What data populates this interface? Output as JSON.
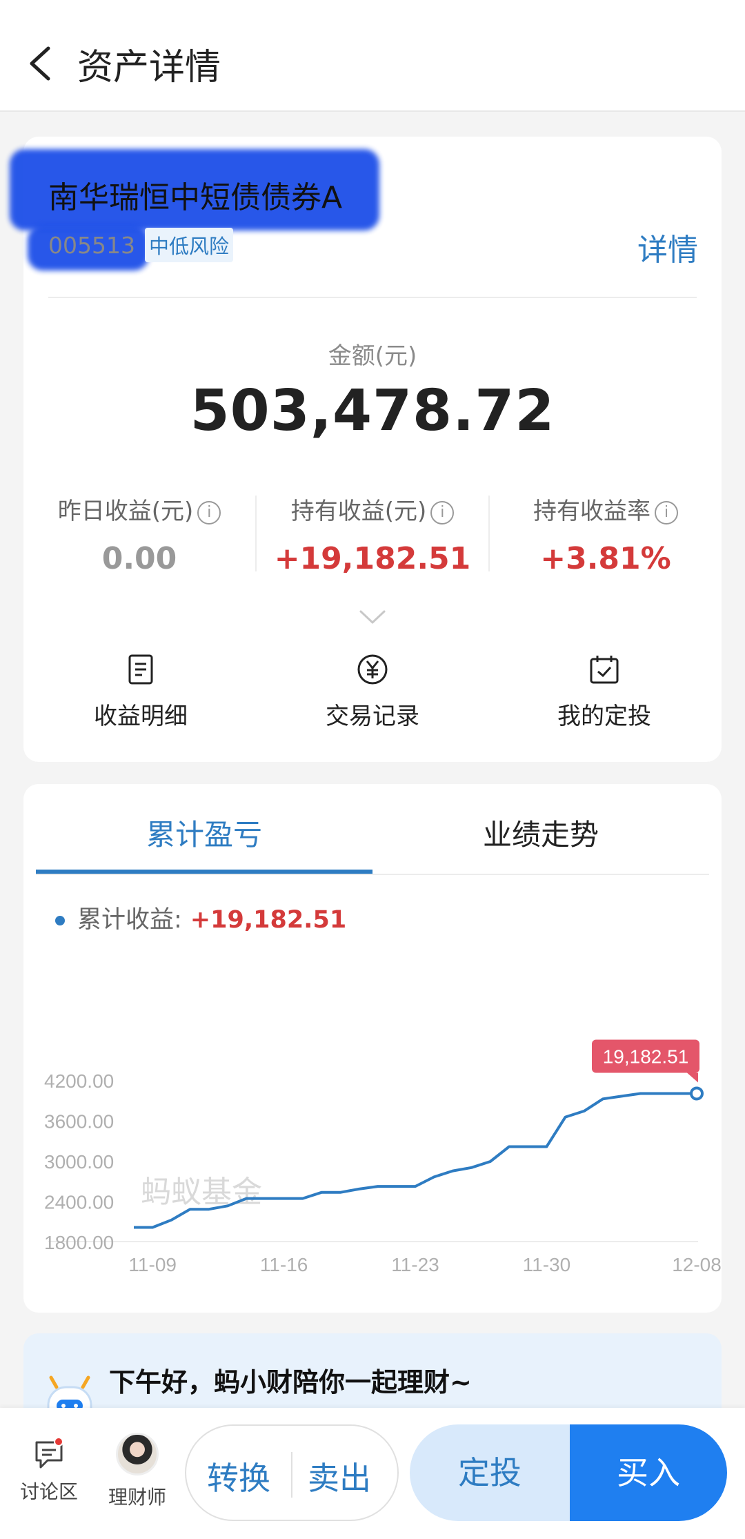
{
  "header": {
    "title": "资产详情"
  },
  "fund": {
    "name": "南华瑞恒中短债债券A",
    "code": "005513",
    "risk": "中低风险",
    "detail_link": "详情"
  },
  "amount": {
    "label": "金额(元)",
    "value": "503,478.72"
  },
  "stats": [
    {
      "label": "昨日收益(元)",
      "value": "0.00"
    },
    {
      "label": "持有收益(元)",
      "value": "+19,182.51"
    },
    {
      "label": "持有收益率",
      "value": "+3.81%"
    }
  ],
  "actions": [
    {
      "label": "收益明细",
      "icon": "document-icon"
    },
    {
      "label": "交易记录",
      "icon": "yen-circle-icon"
    },
    {
      "label": "我的定投",
      "icon": "calendar-check-icon"
    }
  ],
  "tabs": [
    {
      "label": "累计盈亏"
    },
    {
      "label": "业绩走势"
    }
  ],
  "legend": {
    "label": "累计收益:",
    "value": "+19,182.51"
  },
  "tooltip": "19,182.51",
  "watermark": "蚂蚁基金",
  "colors": {
    "accent": "#2e7cc2",
    "gain": "#d43a3a",
    "primary_button": "#1f7ff0",
    "line": "#2e7cc2",
    "tooltip_bg": "#e4566a"
  },
  "chart_data": {
    "type": "line",
    "y_ticks": [
      "4200.00",
      "3600.00",
      "3000.00",
      "2400.00",
      "1800.00"
    ],
    "ylim": [
      1800,
      4200
    ],
    "x_ticks": [
      "11-09",
      "11-16",
      "11-23",
      "11-30",
      "12-08"
    ],
    "x": [
      "11-08",
      "11-09",
      "11-10",
      "11-11",
      "11-12",
      "11-13",
      "11-14",
      "11-15",
      "11-16",
      "11-17",
      "11-18",
      "11-19",
      "11-20",
      "11-21",
      "11-22",
      "11-23",
      "11-24",
      "11-25",
      "11-26",
      "11-27",
      "11-28",
      "11-29",
      "11-30",
      "12-01",
      "12-02",
      "12-03",
      "12-04",
      "12-05",
      "12-06",
      "12-07",
      "12-08"
    ],
    "series": [
      {
        "values": [
          2010,
          2010,
          2120,
          2280,
          2280,
          2330,
          2440,
          2440,
          2440,
          2440,
          2530,
          2530,
          2580,
          2620,
          2620,
          2620,
          2760,
          2850,
          2900,
          2990,
          3210,
          3210,
          3210,
          3650,
          3740,
          3920,
          3960,
          4000,
          4000,
          4000,
          4000
        ]
      }
    ]
  },
  "greeting": "下午好，蚂小财陪你一起理财~",
  "bottom": {
    "nav": [
      {
        "label": "讨论区"
      },
      {
        "label": "理财师"
      }
    ],
    "convert": "转换",
    "sell": "卖出",
    "auto_invest": "定投",
    "buy": "买入"
  }
}
